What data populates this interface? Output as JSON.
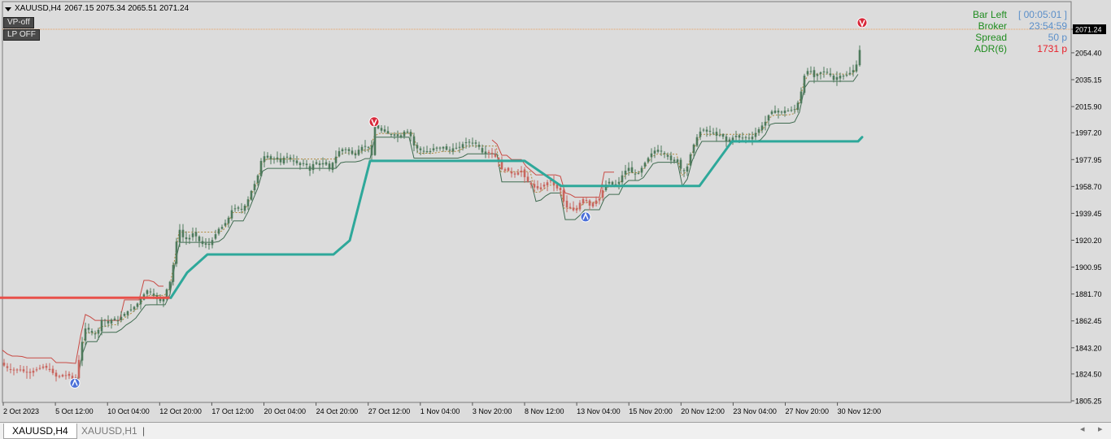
{
  "header": {
    "symbol_label": "XAUUSD,H4",
    "ohlc": "2067.15 2075.34 2065.51 2071.24"
  },
  "buttons": {
    "vp": "VP-off",
    "lp": "LP OFF"
  },
  "info_panel": {
    "labels": [
      "Bar Left",
      "Broker",
      "Spread",
      "ADR(6)"
    ],
    "values": [
      "[ 00:05:01 ]",
      "23:54:59",
      "50 p",
      "1731 p"
    ],
    "value_colors": [
      "#5b8fc9",
      "#5b8fc9",
      "#5b8fc9",
      "#e8202a"
    ]
  },
  "tabs": [
    "XAUUSD,H4",
    "XAUUSD,H1"
  ],
  "scroll": {
    "left": "◂",
    "right": "▸"
  },
  "chart_data": {
    "type": "candlestick",
    "symbol": "XAUUSD",
    "timeframe": "H4",
    "current_price": 2071.24,
    "price_ticks": [
      "2071.24",
      "2054.40",
      "2035.15",
      "2015.90",
      "1997.20",
      "1977.95",
      "1958.70",
      "1939.45",
      "1920.20",
      "1900.95",
      "1881.70",
      "1862.45",
      "1843.20",
      "1824.50",
      "1805.25"
    ],
    "time_ticks": [
      "2 Oct 2023",
      "5 Oct 12:00",
      "10 Oct 04:00",
      "12 Oct 20:00",
      "17 Oct 12:00",
      "20 Oct 04:00",
      "24 Oct 20:00",
      "27 Oct 12:00",
      "1 Nov 04:00",
      "3 Nov 20:00",
      "8 Nov 12:00",
      "13 Nov 04:00",
      "15 Nov 20:00",
      "20 Nov 12:00",
      "23 Nov 04:00",
      "27 Nov 20:00",
      "30 Nov 12:00"
    ],
    "ylim": [
      1805.25,
      2071.24
    ],
    "price_path": [
      [
        0,
        1833
      ],
      [
        8,
        1829
      ],
      [
        16,
        1827
      ],
      [
        24,
        1828
      ],
      [
        30,
        1826
      ],
      [
        38,
        1826
      ],
      [
        46,
        1828
      ],
      [
        54,
        1830
      ],
      [
        62,
        1827
      ],
      [
        70,
        1822
      ],
      [
        78,
        1824
      ],
      [
        86,
        1823
      ],
      [
        92,
        1819
      ],
      [
        96,
        1831
      ],
      [
        100,
        1845
      ],
      [
        105,
        1857
      ],
      [
        110,
        1856
      ],
      [
        116,
        1852
      ],
      [
        121,
        1856
      ],
      [
        126,
        1865
      ],
      [
        132,
        1860
      ],
      [
        138,
        1864
      ],
      [
        144,
        1862
      ],
      [
        150,
        1866
      ],
      [
        156,
        1869
      ],
      [
        162,
        1871
      ],
      [
        168,
        1874
      ],
      [
        175,
        1880
      ],
      [
        182,
        1885
      ],
      [
        188,
        1881
      ],
      [
        193,
        1878
      ],
      [
        199,
        1876
      ],
      [
        204,
        1884
      ],
      [
        208,
        1888
      ],
      [
        212,
        1898
      ],
      [
        216,
        1916
      ],
      [
        220,
        1929
      ],
      [
        226,
        1921
      ],
      [
        232,
        1921
      ],
      [
        238,
        1926
      ],
      [
        244,
        1920
      ],
      [
        250,
        1917
      ],
      [
        256,
        1917
      ],
      [
        262,
        1921
      ],
      [
        268,
        1928
      ],
      [
        274,
        1930
      ],
      [
        280,
        1935
      ],
      [
        286,
        1943
      ],
      [
        292,
        1943
      ],
      [
        298,
        1942
      ],
      [
        304,
        1948
      ],
      [
        310,
        1957
      ],
      [
        316,
        1964
      ],
      [
        321,
        1977
      ],
      [
        327,
        1982
      ],
      [
        333,
        1978
      ],
      [
        339,
        1979
      ],
      [
        345,
        1976
      ],
      [
        351,
        1981
      ],
      [
        357,
        1978
      ],
      [
        363,
        1976
      ],
      [
        369,
        1974
      ],
      [
        375,
        1976
      ],
      [
        381,
        1970
      ],
      [
        387,
        1977
      ],
      [
        393,
        1974
      ],
      [
        399,
        1976
      ],
      [
        405,
        1971
      ],
      [
        411,
        1978
      ],
      [
        417,
        1984
      ],
      [
        423,
        1986
      ],
      [
        429,
        1984
      ],
      [
        435,
        1981
      ],
      [
        441,
        1985
      ],
      [
        447,
        1988
      ],
      [
        453,
        1987
      ],
      [
        457,
        1981
      ],
      [
        461,
        2003
      ],
      [
        467,
        1999
      ],
      [
        473,
        1998
      ],
      [
        479,
        1996
      ],
      [
        485,
        1996
      ],
      [
        491,
        1994
      ],
      [
        497,
        1998
      ],
      [
        503,
        1998
      ],
      [
        509,
        1988
      ],
      [
        515,
        1985
      ],
      [
        521,
        1984
      ],
      [
        527,
        1983
      ],
      [
        533,
        1986
      ],
      [
        539,
        1986
      ],
      [
        545,
        1987
      ],
      [
        551,
        1984
      ],
      [
        557,
        1986
      ],
      [
        563,
        1986
      ],
      [
        569,
        1989
      ],
      [
        575,
        1991
      ],
      [
        581,
        1990
      ],
      [
        587,
        1989
      ],
      [
        593,
        1983
      ],
      [
        599,
        1984
      ],
      [
        605,
        1982
      ],
      [
        611,
        1979
      ],
      [
        617,
        1971
      ],
      [
        623,
        1971
      ],
      [
        629,
        1968
      ],
      [
        635,
        1968
      ],
      [
        641,
        1970
      ],
      [
        647,
        1963
      ],
      [
        653,
        1960
      ],
      [
        659,
        1957
      ],
      [
        665,
        1958
      ],
      [
        671,
        1961
      ],
      [
        677,
        1963
      ],
      [
        683,
        1958
      ],
      [
        689,
        1956
      ],
      [
        695,
        1944
      ],
      [
        701,
        1943
      ],
      [
        707,
        1941
      ],
      [
        713,
        1947
      ],
      [
        719,
        1951
      ],
      [
        725,
        1945
      ],
      [
        731,
        1948
      ],
      [
        737,
        1950
      ],
      [
        743,
        1959
      ],
      [
        749,
        1962
      ],
      [
        755,
        1959
      ],
      [
        761,
        1962
      ],
      [
        767,
        1969
      ],
      [
        773,
        1972
      ],
      [
        779,
        1967
      ],
      [
        785,
        1968
      ],
      [
        791,
        1974
      ],
      [
        797,
        1979
      ],
      [
        803,
        1984
      ],
      [
        809,
        1985
      ],
      [
        815,
        1983
      ],
      [
        821,
        1980
      ],
      [
        827,
        1976
      ],
      [
        833,
        1978
      ],
      [
        839,
        1968
      ],
      [
        845,
        1973
      ],
      [
        851,
        1986
      ],
      [
        857,
        1994
      ],
      [
        863,
        2000
      ],
      [
        869,
        1998
      ],
      [
        875,
        1998
      ],
      [
        881,
        1995
      ],
      [
        887,
        1996
      ],
      [
        893,
        1991
      ],
      [
        899,
        1993
      ],
      [
        905,
        1995
      ],
      [
        911,
        1993
      ],
      [
        917,
        1994
      ],
      [
        923,
        1993
      ],
      [
        929,
        1997
      ],
      [
        935,
        2001
      ],
      [
        941,
        2005
      ],
      [
        947,
        2012
      ],
      [
        953,
        2013
      ],
      [
        959,
        2011
      ],
      [
        965,
        2013
      ],
      [
        971,
        2013
      ],
      [
        977,
        2014
      ],
      [
        983,
        2021
      ],
      [
        989,
        2038
      ],
      [
        995,
        2043
      ],
      [
        1001,
        2037
      ],
      [
        1007,
        2040
      ],
      [
        1013,
        2041
      ],
      [
        1019,
        2040
      ],
      [
        1025,
        2035
      ],
      [
        1031,
        2038
      ],
      [
        1037,
        2038
      ],
      [
        1043,
        2039
      ],
      [
        1049,
        2042
      ],
      [
        1055,
        2048
      ],
      [
        1060,
        2069
      ]
    ],
    "bias_line": [
      {
        "color": "#e8504a",
        "points": [
          [
            0,
            1879
          ],
          [
            210,
            1879
          ]
        ]
      },
      {
        "color": "#2ea89a",
        "points": [
          [
            210,
            1879
          ],
          [
            230,
            1897
          ],
          [
            255,
            1910
          ],
          [
            410,
            1910
          ],
          [
            430,
            1920
          ],
          [
            455,
            1977
          ],
          [
            645,
            1977
          ],
          [
            690,
            1959
          ],
          [
            860,
            1959
          ],
          [
            900,
            1991
          ],
          [
            1055,
            1991
          ],
          [
            1060,
            1994
          ]
        ]
      }
    ],
    "markers": [
      {
        "type": "buy",
        "x": 92,
        "price": 1819
      },
      {
        "type": "sell",
        "x": 460,
        "price": 2005
      },
      {
        "type": "buy",
        "x": 720,
        "price": 1938
      },
      {
        "type": "sell",
        "x": 1060,
        "price": 2076
      }
    ]
  }
}
